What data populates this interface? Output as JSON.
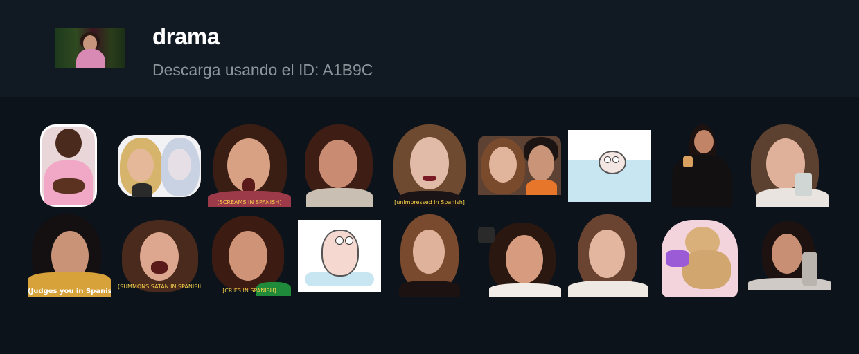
{
  "header": {
    "title": "drama",
    "subtitle": "Descarga usando el ID: A1B9C"
  },
  "stickers": [
    {
      "caption": ""
    },
    {
      "caption": ""
    },
    {
      "caption": "[SCREAMS IN SPANISH]"
    },
    {
      "caption": ""
    },
    {
      "caption": "[unimpressed in Spanish]"
    },
    {
      "caption": ""
    },
    {
      "caption": ""
    },
    {
      "caption": ""
    },
    {
      "caption": ""
    },
    {
      "caption": "(Judges you in Spanish)"
    },
    {
      "caption": "[SUMMONS SATAN IN SPANISH]"
    },
    {
      "caption": "[CRIES IN SPANISH]"
    },
    {
      "caption": ""
    },
    {
      "caption": ""
    },
    {
      "caption": ""
    },
    {
      "caption": ""
    },
    {
      "caption": ""
    },
    {
      "caption": ""
    }
  ],
  "colors": {
    "header_bg": "#111922",
    "page_bg": "#0c131b",
    "caption_yellow": "#f6d24a"
  }
}
